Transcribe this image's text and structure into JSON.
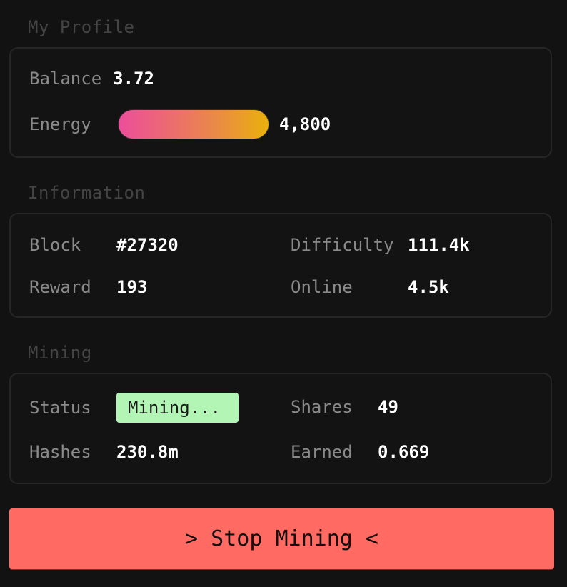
{
  "profile": {
    "title": "My Profile",
    "balance_label": "Balance",
    "balance_value": "3.72",
    "energy_label": "Energy",
    "energy_value": "4,800",
    "energy_fraction": 1.0,
    "energy_gradient": [
      "#ec4e9b",
      "#eab10a"
    ]
  },
  "information": {
    "title": "Information",
    "block_label": "Block",
    "block_value": "#27320",
    "difficulty_label": "Difficulty",
    "difficulty_value": "111.4k",
    "reward_label": "Reward",
    "reward_value": "193",
    "online_label": "Online",
    "online_value": "4.5k"
  },
  "mining": {
    "title": "Mining",
    "status_label": "Status",
    "status_value": "Mining...",
    "status_color": "#b3f5b5",
    "shares_label": "Shares",
    "shares_value": "49",
    "hashes_label": "Hashes",
    "hashes_value": "230.8m",
    "earned_label": "Earned",
    "earned_value": "0.669"
  },
  "actions": {
    "stop_label": "> Stop Mining <",
    "stop_color": "#ff6a63"
  }
}
